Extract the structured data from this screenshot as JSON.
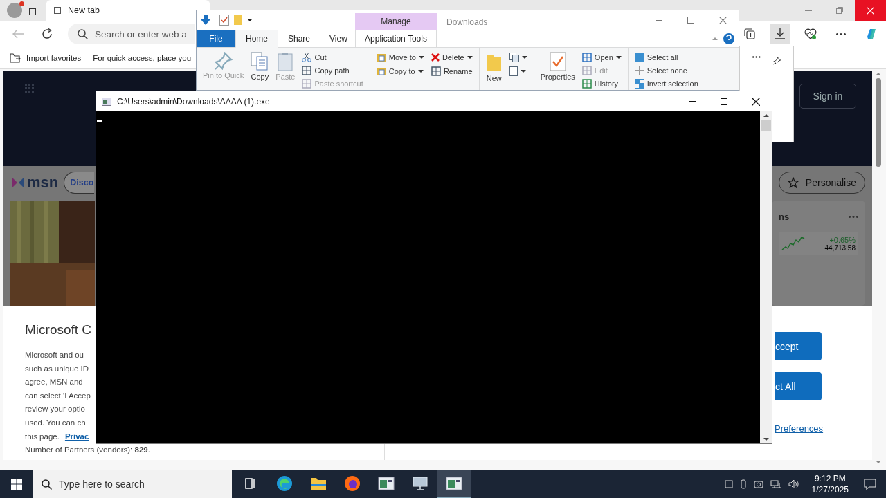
{
  "browser": {
    "tab": {
      "title": "New tab"
    },
    "address_bar": {
      "placeholder": "Search or enter web a"
    },
    "favorites_bar": [
      "Import favorites",
      "For quick access, place you"
    ],
    "toolbar_buttons": [
      {
        "kind": "collections",
        "selected": false
      },
      {
        "kind": "downloads",
        "selected": true
      },
      {
        "kind": "health",
        "selected": false
      },
      {
        "kind": "more",
        "selected": false
      },
      {
        "kind": "copilot",
        "selected": false
      }
    ]
  },
  "msn": {
    "logo": "msn",
    "nav_button": "Disco",
    "sign_in": "Sign in",
    "personalise": "Personalise",
    "markets": {
      "heading": "ns",
      "change": "+0.65%",
      "value": "44,713.58"
    }
  },
  "consent": {
    "title": "Microsoft C",
    "lines": [
      "Microsoft and ou",
      "such as unique ID",
      "agree, MSN and",
      "can select 'I Accep",
      "review your optio",
      "used. You can ch"
    ],
    "privacy_prefix": "this page.",
    "privacy_link": "Privac",
    "partners": "Number of Partners (vendors): **829**.",
    "buttons": [
      "ccept",
      "ct All"
    ],
    "preferences_link": "Preferences"
  },
  "explorer": {
    "title": "Downloads",
    "context_header": "Manage",
    "tabs": [
      {
        "label": "File",
        "kind": "file",
        "selected": false
      },
      {
        "label": "Home",
        "kind": "tab",
        "selected": true
      },
      {
        "label": "Share",
        "kind": "tab",
        "selected": false
      },
      {
        "label": "View",
        "kind": "tab",
        "selected": false
      },
      {
        "label": "Application Tools",
        "kind": "context",
        "selected": false
      }
    ],
    "groups": [
      {
        "columns": [
          {
            "kind": "big",
            "items": [
              {
                "label": "Pin to Quick",
                "kind": "pin",
                "disabled": true
              },
              {
                "label": "Copy",
                "kind": "copy",
                "disabled": false
              },
              {
                "label": "Paste",
                "kind": "paste",
                "disabled": true
              }
            ]
          },
          {
            "kind": "small",
            "items": [
              {
                "label": "Cut",
                "kind": "cut",
                "disabled": false
              },
              {
                "label": "Copy path",
                "kind": "path",
                "disabled": false
              },
              {
                "label": "Paste shortcut",
                "kind": "shortcut",
                "disabled": true
              }
            ]
          }
        ]
      },
      {
        "columns": [
          {
            "kind": "small",
            "items": [
              {
                "label": "Move to",
                "kind": "move",
                "disabled": false,
                "dropdown": true
              },
              {
                "label": "Copy to",
                "kind": "copyto",
                "disabled": false,
                "dropdown": true
              }
            ]
          },
          {
            "kind": "small",
            "items": [
              {
                "label": "Delete",
                "kind": "delete",
                "disabled": false,
                "dropdown": true
              },
              {
                "label": "Rename",
                "kind": "rename",
                "disabled": false,
                "dropdown": false
              }
            ]
          }
        ]
      },
      {
        "columns": [
          {
            "kind": "big",
            "items": [
              {
                "label": "New",
                "kind": "folder",
                "disabled": false
              }
            ]
          },
          {
            "kind": "icons"
          }
        ]
      },
      {
        "columns": [
          {
            "kind": "big",
            "items": [
              {
                "label": "Properties",
                "kind": "properties",
                "disabled": false
              }
            ]
          },
          {
            "kind": "small",
            "items": [
              {
                "label": "Open",
                "kind": "open",
                "disabled": false,
                "dropdown": true
              },
              {
                "label": "Edit",
                "kind": "edit",
                "disabled": true,
                "dropdown": false
              },
              {
                "label": "History",
                "kind": "history",
                "disabled": false,
                "dropdown": false
              }
            ]
          }
        ]
      },
      {
        "columns": [
          {
            "kind": "small",
            "items": [
              {
                "label": "Select all",
                "kind": "selall",
                "disabled": false
              },
              {
                "label": "Select none",
                "kind": "selnone",
                "disabled": false
              },
              {
                "label": "Invert selection",
                "kind": "invert",
                "disabled": false
              }
            ]
          }
        ]
      }
    ]
  },
  "console": {
    "title": "C:\\Users\\admin\\Downloads\\AAAA (1).exe"
  },
  "taskbar": {
    "search_placeholder": "Type here to search",
    "apps": [
      {
        "kind": "taskview",
        "selected": false
      },
      {
        "kind": "edge",
        "selected": false
      },
      {
        "kind": "explorer",
        "selected": false
      },
      {
        "kind": "firefox",
        "selected": false
      },
      {
        "kind": "window",
        "selected": false
      },
      {
        "kind": "monitor",
        "selected": false
      },
      {
        "kind": "window",
        "selected": true
      }
    ],
    "time": "9:12 PM",
    "date": "1/27/2025"
  }
}
